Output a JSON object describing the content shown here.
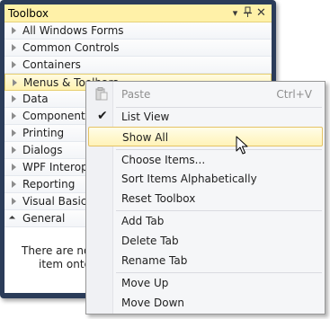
{
  "toolbox": {
    "title": "Toolbox",
    "title_buttons": {
      "dropdown": "▾",
      "pin": "📌",
      "close": "✕"
    },
    "categories": [
      {
        "label": "All Windows Forms",
        "expanded": false,
        "hover": false
      },
      {
        "label": "Common Controls",
        "expanded": false,
        "hover": false
      },
      {
        "label": "Containers",
        "expanded": false,
        "hover": false
      },
      {
        "label": "Menus & Toolbars",
        "expanded": false,
        "hover": true
      },
      {
        "label": "Data",
        "expanded": false,
        "hover": false
      },
      {
        "label": "Components",
        "expanded": false,
        "hover": false
      },
      {
        "label": "Printing",
        "expanded": false,
        "hover": false
      },
      {
        "label": "Dialogs",
        "expanded": false,
        "hover": false
      },
      {
        "label": "WPF Interoperability",
        "expanded": false,
        "hover": false
      },
      {
        "label": "Reporting",
        "expanded": false,
        "hover": false
      },
      {
        "label": "Visual Basic PowerPacks",
        "expanded": false,
        "hover": false
      },
      {
        "label": "General",
        "expanded": true,
        "hover": false
      }
    ],
    "empty_message_line1": "There are no usable controls in this group. Drag an",
    "empty_message_line2": "item onto this text to add it to the toolbox."
  },
  "context_menu": {
    "paste": {
      "label": "Paste",
      "shortcut": "Ctrl+V",
      "enabled": false
    },
    "list_view": {
      "label": "List View",
      "checked": true
    },
    "show_all": {
      "label": "Show All",
      "highlighted": true
    },
    "choose_items": {
      "label": "Choose Items..."
    },
    "sort_items": {
      "label": "Sort Items Alphabetically"
    },
    "reset_toolbox": {
      "label": "Reset Toolbox"
    },
    "add_tab": {
      "label": "Add Tab"
    },
    "delete_tab": {
      "label": "Delete Tab"
    },
    "rename_tab": {
      "label": "Rename Tab"
    },
    "move_up": {
      "label": "Move Up"
    },
    "move_down": {
      "label": "Move Down"
    }
  },
  "colors": {
    "frame": "#2b3c59",
    "title_bar": "#fff1a8",
    "highlight": "#fff3b8",
    "highlight_border": "#e5c365"
  }
}
